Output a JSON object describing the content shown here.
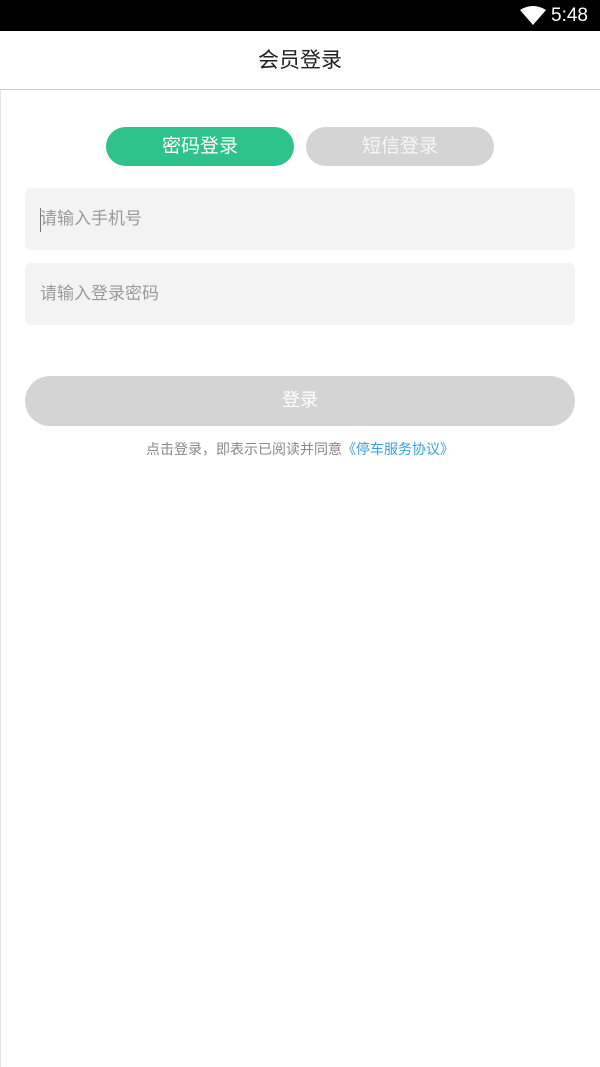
{
  "status_bar": {
    "time": "5:48",
    "wifi_icon": "wifi-icon"
  },
  "header": {
    "title": "会员登录"
  },
  "tabs": [
    {
      "label": "密码登录",
      "active": true
    },
    {
      "label": "短信登录",
      "active": false
    }
  ],
  "form": {
    "phone_placeholder": "请输入手机号",
    "password_placeholder": "请输入登录密码",
    "phone_value": "",
    "password_value": ""
  },
  "login_button": {
    "label": "登录"
  },
  "agreement": {
    "prefix": "点击登录，即表示已阅读并同意",
    "link": "《停车服务协议》"
  },
  "colors": {
    "accent": "#2ec38a",
    "disabled": "#d4d4d4",
    "link": "#3aa0d6",
    "field_bg": "#f3f3f3"
  }
}
